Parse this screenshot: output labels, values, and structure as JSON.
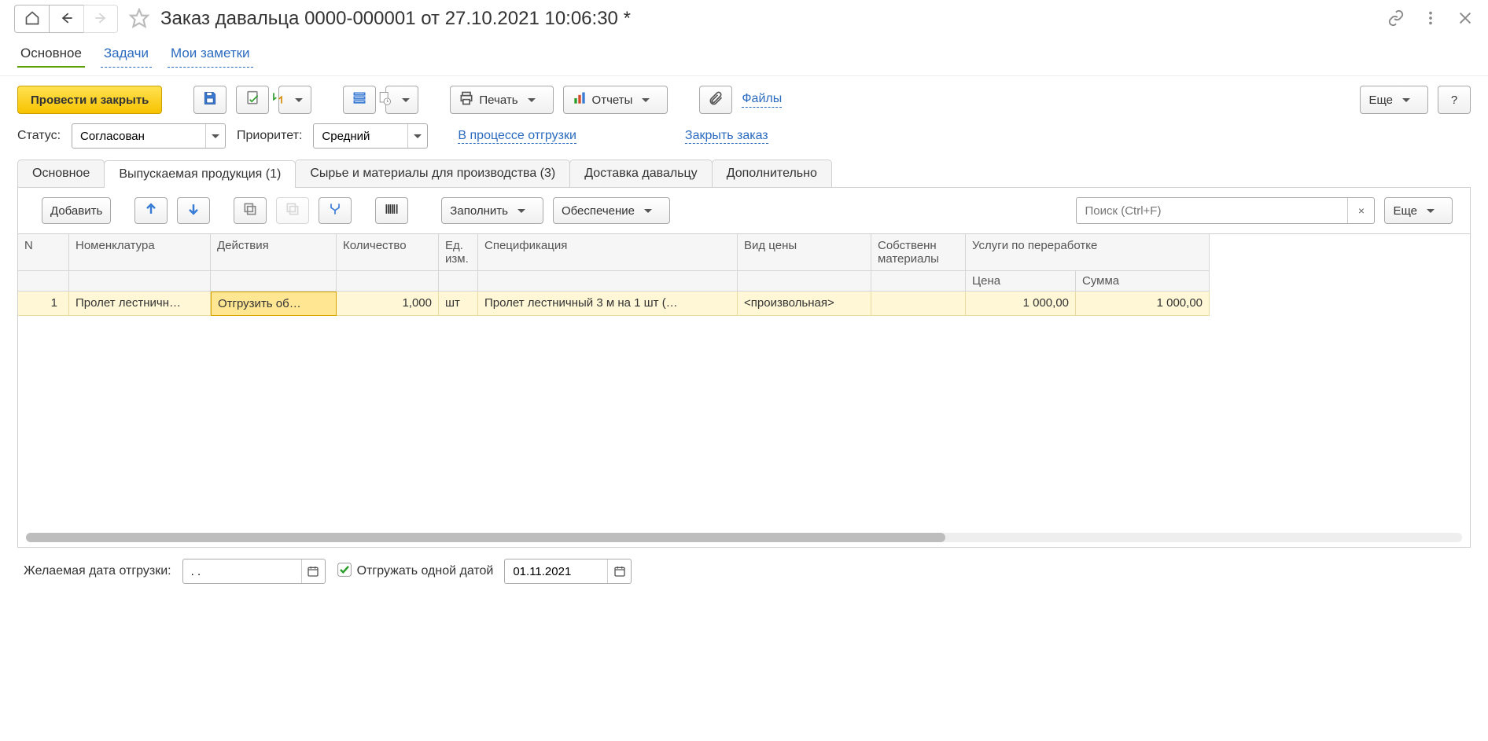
{
  "header": {
    "title": "Заказ давальца 0000-000001 от 27.10.2021 10:06:30 *"
  },
  "viewtabs": {
    "main": "Основное",
    "tasks": "Задачи",
    "notes": "Мои заметки"
  },
  "toolbar": {
    "post_close": "Провести и закрыть",
    "print": "Печать",
    "reports": "Отчеты",
    "files": "Файлы",
    "more": "Еще",
    "help": "?"
  },
  "statusrow": {
    "status_label": "Статус:",
    "status_value": "Согласован",
    "priority_label": "Приоритет:",
    "priority_value": "Средний",
    "shipping_state": "В процессе отгрузки",
    "close_order": "Закрыть заказ"
  },
  "tabs": {
    "t1": "Основное",
    "t2": "Выпускаемая продукция (1)",
    "t3": "Сырье и материалы для производства (3)",
    "t4": "Доставка давальцу",
    "t5": "Дополнительно"
  },
  "tabtoolbar": {
    "add": "Добавить",
    "fill": "Заполнить",
    "supply": "Обеспечение",
    "search_ph": "Поиск (Ctrl+F)",
    "more": "Еще"
  },
  "table": {
    "headers": {
      "n": "N",
      "item": "Номенклатура",
      "actions": "Действия",
      "qty": "Количество",
      "unit": "Ед. изм.",
      "spec": "Спецификация",
      "price_type": "Вид цены",
      "own_materials": "Собственн материалы",
      "services": "Услуги по переработке",
      "price": "Цена",
      "sum": "Сумма"
    },
    "rows": [
      {
        "n": "1",
        "item": "Пролет лестничн…",
        "action": "Отгрузить об…",
        "qty": "1,000",
        "unit": "шт",
        "spec": "Пролет лестничный 3 м на 1 шт (…",
        "price_type": "<произвольная>",
        "own": "",
        "price": "1 000,00",
        "sum": "1 000,00"
      }
    ]
  },
  "footer": {
    "desired_label": "Желаемая дата отгрузки:",
    "desired_value": ". .",
    "ship_one_date": "Отгружать одной датой",
    "ship_date": "01.11.2021"
  }
}
